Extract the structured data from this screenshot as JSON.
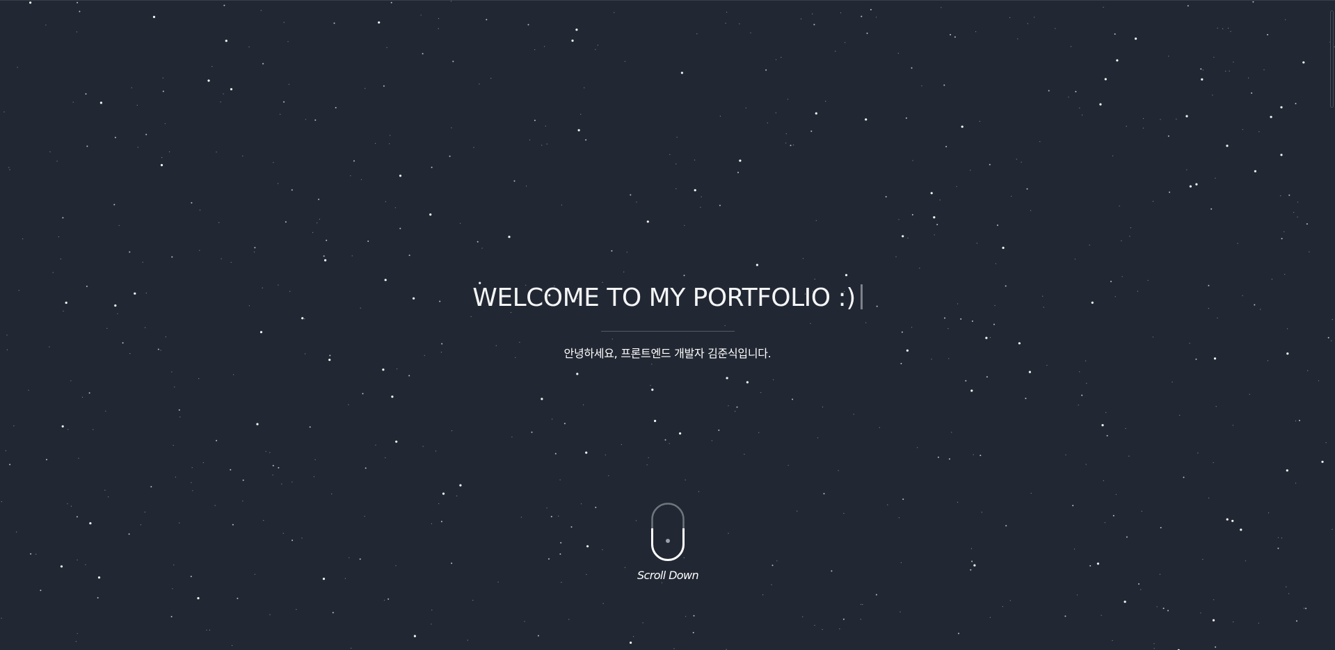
{
  "hero": {
    "title": "WELCOME TO MY PORTFOLIO :)",
    "subtitle": "안녕하세요, 프론트엔드 개발자 김준식입니다."
  },
  "scroll_indicator": {
    "label": "Scroll Down",
    "icon": "mouse-icon"
  },
  "colors": {
    "background": "#222833",
    "text": "#ffffff",
    "divider": "#555b64",
    "cursor": "#7d828b",
    "star": "#ffffff"
  }
}
